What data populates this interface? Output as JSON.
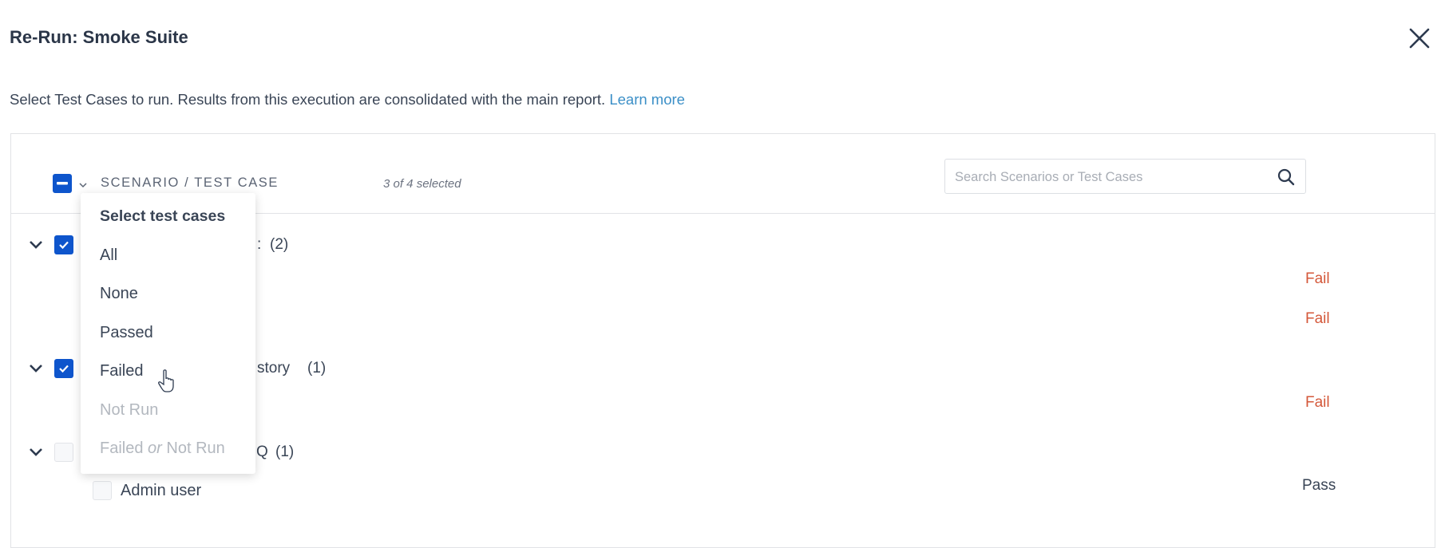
{
  "dialog": {
    "title": "Re-Run: Smoke Suite",
    "subtitle": "Select Test Cases to run. Results from this execution are consolidated with the main report.",
    "learn_more": "Learn more",
    "close_icon": "close-icon"
  },
  "table": {
    "header_label": "SCENARIO / TEST CASE",
    "selected_count": "3 of 4 selected",
    "search_placeholder": "Search Scenarios or Test Cases",
    "search_icon": "search-icon"
  },
  "scenarios": [
    {
      "visible_name": ":",
      "count": "(2)",
      "checked": true,
      "results": [
        "Fail",
        "Fail"
      ]
    },
    {
      "visible_name": "story",
      "count": "(1)",
      "checked": true,
      "results": [
        "Fail"
      ]
    },
    {
      "visible_name": "Q",
      "count": "(1)",
      "checked": false,
      "test_cases": [
        {
          "name": "Admin user",
          "checked": false,
          "result": "Pass"
        }
      ]
    }
  ],
  "dropdown": {
    "heading": "Select test cases",
    "items": [
      {
        "label": "All",
        "enabled": true
      },
      {
        "label": "None",
        "enabled": true
      },
      {
        "label": "Passed",
        "enabled": true
      },
      {
        "label": "Failed",
        "enabled": true
      },
      {
        "label": "Not Run",
        "enabled": false
      },
      {
        "label_a": "Failed",
        "label_or": "or",
        "label_b": "Not Run",
        "enabled": false
      }
    ]
  },
  "colors": {
    "accent": "#0e55cc",
    "link": "#3b8fc7",
    "fail": "#d4583a",
    "text": "#2d3a4f"
  }
}
